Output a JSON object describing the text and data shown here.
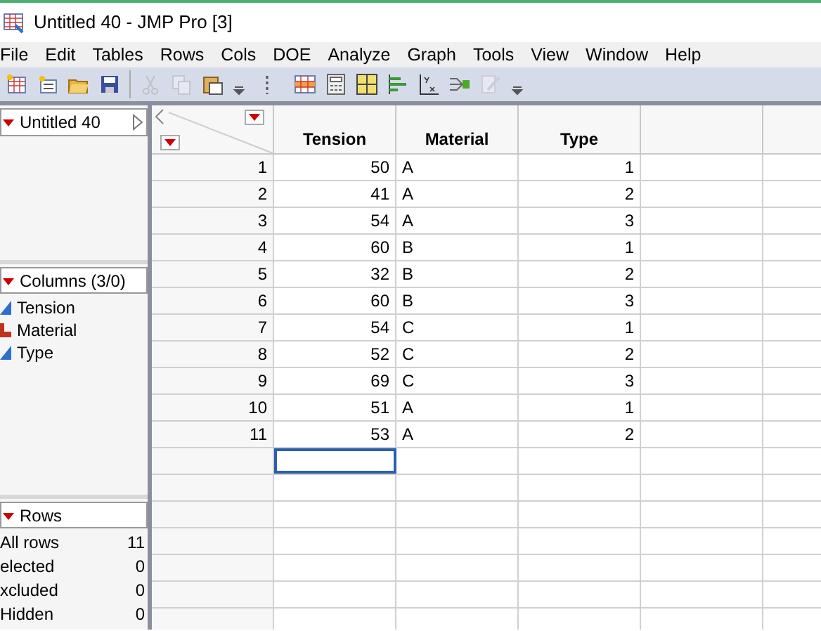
{
  "window": {
    "title": "Untitled 40 - JMP Pro [3]"
  },
  "menu": [
    "File",
    "Edit",
    "Tables",
    "Rows",
    "Cols",
    "DOE",
    "Analyze",
    "Graph",
    "Tools",
    "View",
    "Window",
    "Help"
  ],
  "toolbar": [
    {
      "kind": "newtable",
      "disabled": false
    },
    {
      "kind": "newscript",
      "disabled": false
    },
    {
      "kind": "open",
      "disabled": false
    },
    {
      "kind": "save",
      "disabled": false
    },
    {
      "kind": "sep"
    },
    {
      "kind": "cut",
      "disabled": true
    },
    {
      "kind": "copy",
      "disabled": true
    },
    {
      "kind": "paste",
      "disabled": false
    },
    {
      "kind": "more",
      "disabled": false
    },
    {
      "kind": "grip",
      "disabled": false
    },
    {
      "kind": "table",
      "disabled": false
    },
    {
      "kind": "calc",
      "disabled": false
    },
    {
      "kind": "grid",
      "disabled": false
    },
    {
      "kind": "bars",
      "disabled": false
    },
    {
      "kind": "fit",
      "disabled": false
    },
    {
      "kind": "tree",
      "disabled": false
    },
    {
      "kind": "edit",
      "disabled": true
    },
    {
      "kind": "more",
      "disabled": false
    }
  ],
  "table_panel": {
    "title": "Untitled 40"
  },
  "columns_panel": {
    "title": "Columns (3/0)",
    "items": [
      {
        "name": "Tension",
        "kind": "continuous"
      },
      {
        "name": "Material",
        "kind": "nominal"
      },
      {
        "name": "Type",
        "kind": "continuous"
      }
    ]
  },
  "rows_panel": {
    "title": "Rows",
    "items": [
      {
        "label": "All rows",
        "count": "11"
      },
      {
        "label": "elected",
        "count": "0"
      },
      {
        "label": "xcluded",
        "count": "0"
      },
      {
        "label": "Hidden",
        "count": "0"
      }
    ]
  },
  "table": {
    "columns": [
      "Tension",
      "Material",
      "Type"
    ],
    "rows": [
      [
        "1",
        "50",
        "A",
        "1"
      ],
      [
        "2",
        "41",
        "A",
        "2"
      ],
      [
        "3",
        "54",
        "A",
        "3"
      ],
      [
        "4",
        "60",
        "B",
        "1"
      ],
      [
        "5",
        "32",
        "B",
        "2"
      ],
      [
        "6",
        "60",
        "B",
        "3"
      ],
      [
        "7",
        "54",
        "C",
        "1"
      ],
      [
        "8",
        "52",
        "C",
        "2"
      ],
      [
        "9",
        "69",
        "C",
        "3"
      ],
      [
        "10",
        "51",
        "A",
        "1"
      ],
      [
        "11",
        "53",
        "A",
        "2"
      ]
    ]
  }
}
